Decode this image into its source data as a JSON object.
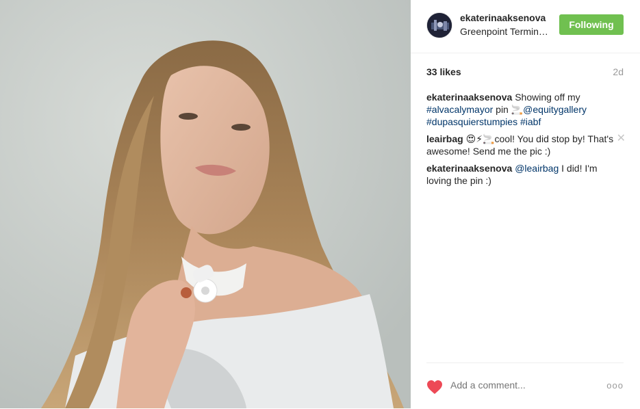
{
  "post": {
    "username": "ekaterinaaksenova",
    "location": "Greenpoint Terminal Market",
    "follow_label": "Following",
    "likes": "33 likes",
    "age": "2d"
  },
  "comments": [
    {
      "author": "ekaterinaaksenova",
      "parts": [
        {
          "t": " Showing off my "
        },
        {
          "t": "#alvacalymayor",
          "tag": true
        },
        {
          "t": " pin 🚬"
        },
        {
          "t": "@equitygallery",
          "tag": true
        },
        {
          "t": " "
        },
        {
          "t": "#dupasquierstumpies",
          "tag": true
        },
        {
          "t": " "
        },
        {
          "t": "#iabf",
          "tag": true
        }
      ]
    },
    {
      "author": "leairbag",
      "parts": [
        {
          "t": " 😍⚡🚬cool! You did stop by! That's awesome! Send me the pic :)"
        }
      ],
      "deletable": true
    },
    {
      "author": "ekaterinaaksenova",
      "parts": [
        {
          "t": " "
        },
        {
          "t": "@leairbag",
          "tag": true
        },
        {
          "t": " I did! I'm loving the pin :)"
        }
      ]
    }
  ],
  "footer": {
    "comment_placeholder": "Add a comment...",
    "more_label": "ooo",
    "delete_glyph": "✕"
  },
  "colors": {
    "follow_green": "#70c050",
    "heart_red": "#ed4956",
    "link_blue": "#003569"
  }
}
